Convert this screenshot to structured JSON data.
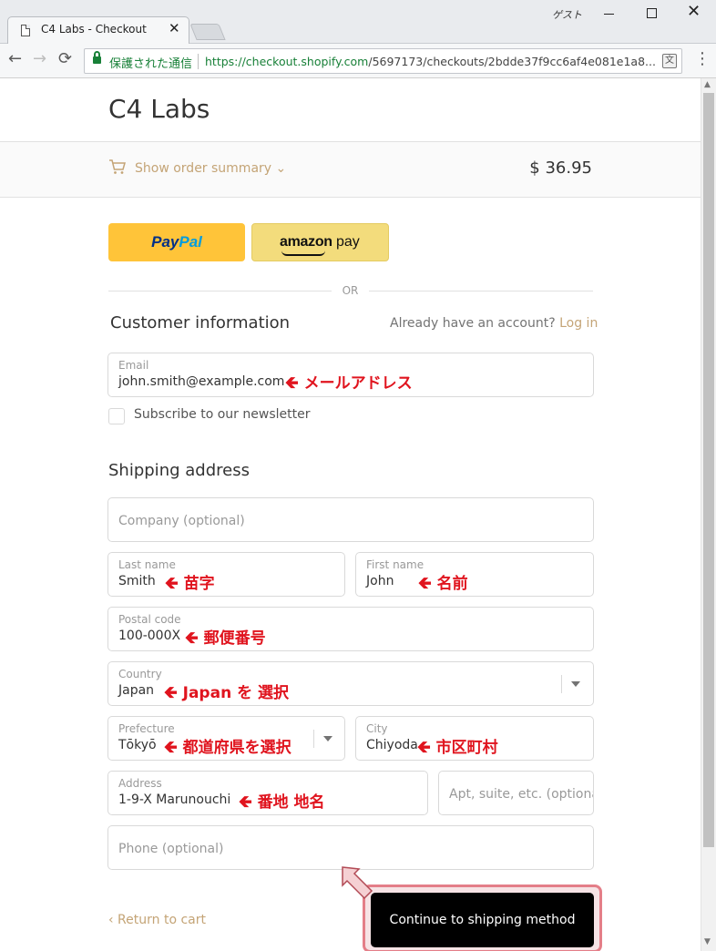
{
  "browser": {
    "tab_title": "C4 Labs - Checkout",
    "tab_close": "✕",
    "window_user": "ゲスト",
    "secure_label": "保護された通信",
    "url_host": "https://checkout.shopify.com",
    "url_path": "/5697173/checkouts/2bdde37f9cc6af4e081e1a8...",
    "nav_back": "←",
    "nav_forward": "→",
    "nav_reload": "⟳",
    "menu": "⋮",
    "translate": "文"
  },
  "store": {
    "name": "C4 Labs"
  },
  "summary": {
    "toggle_label": "Show order summary ⌄",
    "total": "$ 36.95"
  },
  "express": {
    "paypal_pay": "Pay",
    "paypal_pal": "Pal",
    "amazon_brand": "amazon",
    "amazon_pay": "pay",
    "or_label": "OR"
  },
  "customer": {
    "title": "Customer information",
    "account_prompt": "Already have an account?",
    "login_link": "Log in",
    "email": {
      "label": "Email",
      "value": "john.smith@example.com"
    },
    "newsletter_label": "Subscribe to our newsletter"
  },
  "shipping": {
    "title": "Shipping address",
    "company": {
      "placeholder": "Company (optional)"
    },
    "last_name": {
      "label": "Last name",
      "value": "Smith"
    },
    "first_name": {
      "label": "First name",
      "value": "John"
    },
    "postal_code": {
      "label": "Postal code",
      "value": "100-000X"
    },
    "country": {
      "label": "Country",
      "value": "Japan"
    },
    "prefecture": {
      "label": "Prefecture",
      "value": "Tōkyō"
    },
    "city": {
      "label": "City",
      "value": "Chiyoda"
    },
    "address": {
      "label": "Address",
      "value": "1-9-X Marunouchi"
    },
    "apt": {
      "placeholder": "Apt, suite, etc. (optional)"
    },
    "phone": {
      "placeholder": "Phone (optional)"
    }
  },
  "annotations": {
    "arrow": "🡸",
    "email": "メールアドレス",
    "last_name": "苗字",
    "first_name": "名前",
    "postal_code": "郵便番号",
    "country": "Japan を 選択",
    "prefecture": "都道府県を選択",
    "city": "市区町村",
    "address": "番地 地名"
  },
  "footer": {
    "return_label": "‹ Return to cart",
    "continue_label": "Continue to shipping method"
  },
  "colors": {
    "accent": "#c4a476",
    "annotation_red": "#e0141e",
    "paypal_yellow": "#ffc439",
    "amazon_yellow": "#f3dc7c",
    "button_black": "#000000"
  }
}
